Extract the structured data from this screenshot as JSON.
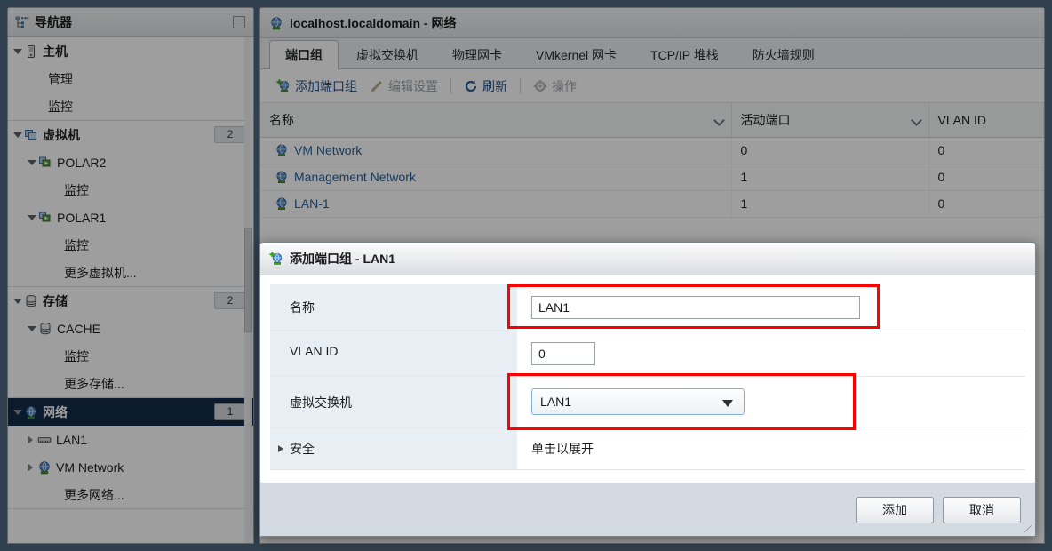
{
  "navigator": {
    "title": "导航器",
    "collapse_icon": "collapse-panel-icon",
    "sections": [
      {
        "id": "host",
        "items": [
          {
            "label": "主机",
            "icon": "host-icon",
            "expander": "down",
            "indent": 0,
            "bold": true
          },
          {
            "label": "管理",
            "icon": "none",
            "expander": "none",
            "indent": 1,
            "bold": false
          },
          {
            "label": "监控",
            "icon": "none",
            "expander": "none",
            "indent": 1,
            "bold": false
          }
        ]
      },
      {
        "id": "vms",
        "items": [
          {
            "label": "虚拟机",
            "icon": "vm-group-icon",
            "expander": "down",
            "indent": 0,
            "bold": true,
            "badge": "2"
          },
          {
            "label": "POLAR2",
            "icon": "vm-icon",
            "expander": "down",
            "indent": 1,
            "bold": false
          },
          {
            "label": "监控",
            "icon": "none",
            "expander": "none",
            "indent": 2,
            "bold": false
          },
          {
            "label": "POLAR1",
            "icon": "vm-icon",
            "expander": "down",
            "indent": 1,
            "bold": false
          },
          {
            "label": "监控",
            "icon": "none",
            "expander": "none",
            "indent": 2,
            "bold": false
          },
          {
            "label": "更多虚拟机...",
            "icon": "none",
            "expander": "none",
            "indent": 2,
            "bold": false
          }
        ]
      },
      {
        "id": "storage",
        "items": [
          {
            "label": "存储",
            "icon": "storage-icon",
            "expander": "down",
            "indent": 0,
            "bold": true,
            "badge": "2"
          },
          {
            "label": "CACHE",
            "icon": "datastore-icon",
            "expander": "down",
            "indent": 1,
            "bold": false
          },
          {
            "label": "监控",
            "icon": "none",
            "expander": "none",
            "indent": 2,
            "bold": false
          },
          {
            "label": "更多存储...",
            "icon": "none",
            "expander": "none",
            "indent": 2,
            "bold": false
          }
        ]
      },
      {
        "id": "network",
        "items": [
          {
            "label": "网络",
            "icon": "network-icon",
            "expander": "down",
            "indent": 0,
            "bold": true,
            "badge": "1",
            "selected": true
          },
          {
            "label": "LAN1",
            "icon": "switch-icon",
            "expander": "right",
            "indent": 1,
            "bold": false
          },
          {
            "label": "VM Network",
            "icon": "network-icon",
            "expander": "right",
            "indent": 1,
            "bold": false
          },
          {
            "label": "更多网络...",
            "icon": "none",
            "expander": "none",
            "indent": 2,
            "bold": false
          }
        ]
      }
    ]
  },
  "content": {
    "title": "localhost.localdomain - 网络",
    "title_icon": "network-icon",
    "tabs": [
      {
        "label": "端口组",
        "active": true
      },
      {
        "label": "虚拟交换机",
        "active": false
      },
      {
        "label": "物理网卡",
        "active": false
      },
      {
        "label": "VMkernel 网卡",
        "active": false
      },
      {
        "label": "TCP/IP 堆栈",
        "active": false
      },
      {
        "label": "防火墙规则",
        "active": false
      }
    ],
    "toolbar": [
      {
        "label": "添加端口组",
        "icon": "add-portgroup-icon",
        "disabled": false,
        "sep_after": false
      },
      {
        "label": "编辑设置",
        "icon": "pencil-icon",
        "disabled": true,
        "sep_after": true
      },
      {
        "label": "刷新",
        "icon": "refresh-icon",
        "disabled": false,
        "sep_after": true
      },
      {
        "label": "操作",
        "icon": "gear-icon",
        "disabled": true,
        "sep_after": false
      }
    ],
    "table": {
      "columns": [
        {
          "label": "名称",
          "sortable": true
        },
        {
          "label": "活动端口",
          "sortable": true
        },
        {
          "label": "VLAN ID",
          "sortable": false
        }
      ],
      "rows": [
        {
          "name": "VM Network",
          "icon": "network-icon",
          "active_ports": "0",
          "vlan_id": "0"
        },
        {
          "name": "Management Network",
          "icon": "network-icon",
          "active_ports": "1",
          "vlan_id": "0"
        },
        {
          "name": "LAN-1",
          "icon": "network-icon",
          "active_ports": "1",
          "vlan_id": "0"
        }
      ]
    }
  },
  "dialog": {
    "title": "添加端口组 - LAN1",
    "title_icon": "add-portgroup-icon",
    "fields": {
      "name": {
        "label": "名称",
        "value": "LAN1"
      },
      "vlan": {
        "label": "VLAN ID",
        "value": "0"
      },
      "vswitch": {
        "label": "虚拟交换机",
        "value": "LAN1"
      },
      "security": {
        "label": "安全",
        "value": "单击以展开",
        "expander": "right"
      }
    },
    "buttons": {
      "add": "添加",
      "cancel": "取消"
    },
    "highlight_color": "#ff0000"
  }
}
